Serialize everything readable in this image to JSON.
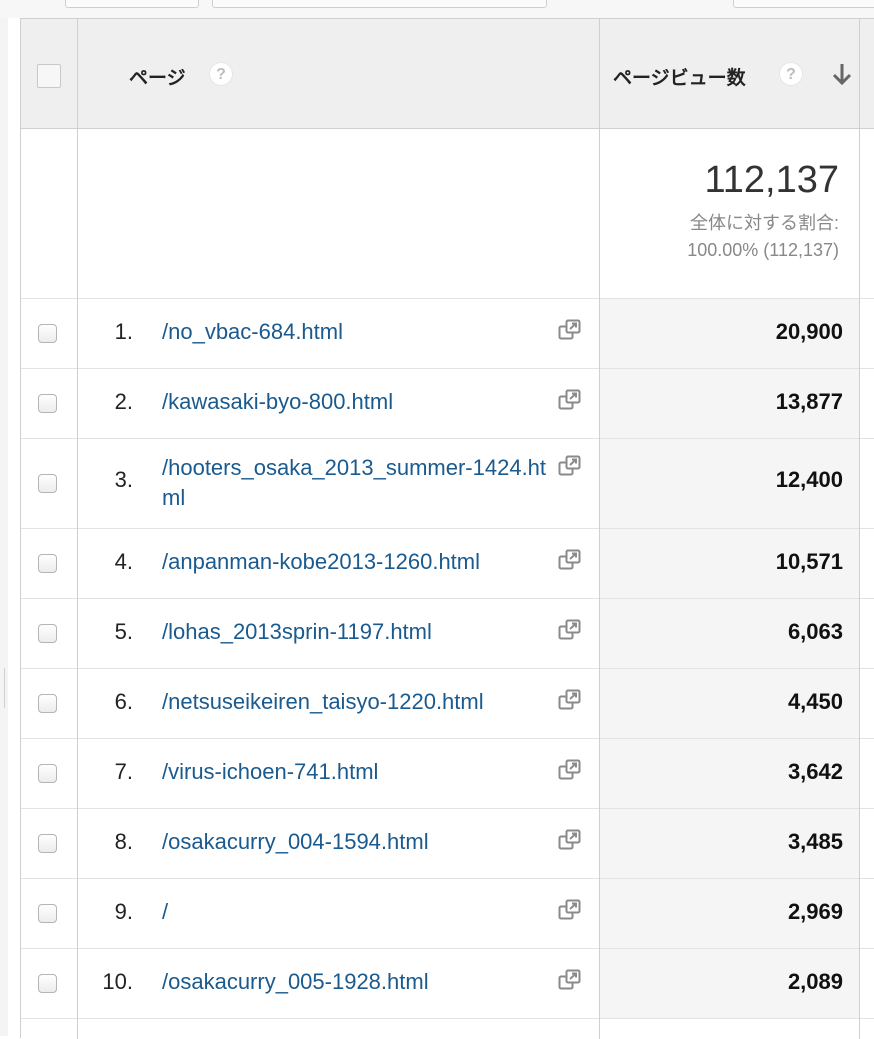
{
  "header": {
    "page_label": "ページ",
    "pageviews_label": "ページビュー数",
    "help_glyph": "?"
  },
  "summary": {
    "total": "112,137",
    "share_label": "全体に対する割合:",
    "share_value": "100.00% (112,137)"
  },
  "rows": [
    {
      "rank": "1.",
      "page": "/no_vbac-684.html",
      "pageviews": "20,900"
    },
    {
      "rank": "2.",
      "page": "/kawasaki-byo-800.html",
      "pageviews": "13,877"
    },
    {
      "rank": "3.",
      "page": "/hooters_osaka_2013_summer-1424.html",
      "pageviews": "12,400"
    },
    {
      "rank": "4.",
      "page": "/anpanman-kobe2013-1260.html",
      "pageviews": "10,571"
    },
    {
      "rank": "5.",
      "page": "/lohas_2013sprin-1197.html",
      "pageviews": "6,063"
    },
    {
      "rank": "6.",
      "page": "/netsuseikeiren_taisyo-1220.html",
      "pageviews": "4,450"
    },
    {
      "rank": "7.",
      "page": "/virus-ichoen-741.html",
      "pageviews": "3,642"
    },
    {
      "rank": "8.",
      "page": "/osakacurry_004-1594.html",
      "pageviews": "3,485"
    },
    {
      "rank": "9.",
      "page": "/",
      "pageviews": "2,969"
    },
    {
      "rank": "10.",
      "page": "/osakacurry_005-1928.html",
      "pageviews": "2,089"
    }
  ],
  "icons": {
    "help": "help-circle-icon",
    "sort": "arrow-down-icon",
    "open": "open-in-new-window-icon"
  },
  "colors": {
    "link": "#1a5a8e",
    "header_bg": "#efefef",
    "metric_bg": "#f5f5f5"
  }
}
